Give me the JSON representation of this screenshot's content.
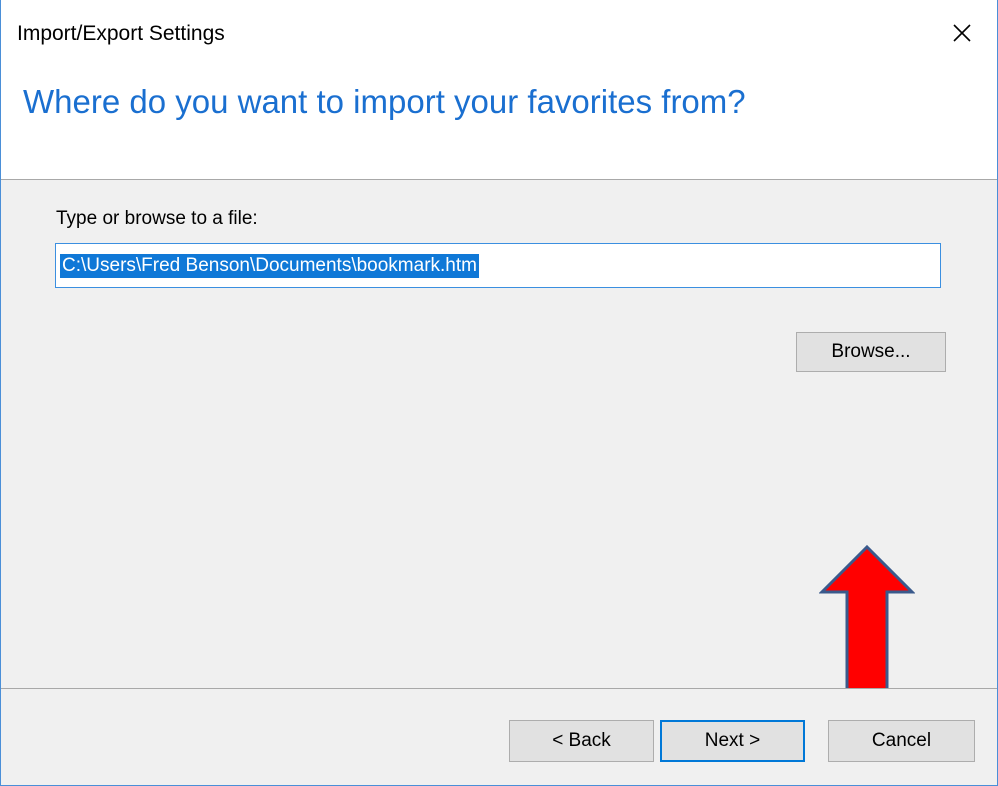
{
  "window": {
    "title": "Import/Export Settings",
    "close_icon": "close-icon"
  },
  "header": {
    "title": "Where do you want to import your favorites from?"
  },
  "main": {
    "field_label": "Type or browse to a file:",
    "file_path": "C:\\Users\\Fred Benson\\Documents\\bookmark.htm",
    "browse_label": "Browse..."
  },
  "footer": {
    "back_label": "< Back",
    "next_label": "Next >",
    "cancel_label": "Cancel"
  },
  "annotation": {
    "arrow_icon": "red-up-arrow-icon",
    "arrow_color": "#ff0000",
    "arrow_outline": "#3a5a8c"
  },
  "colors": {
    "accent": "#1a6fd0",
    "selection": "#0f78d7",
    "focus_border": "#0078d7"
  }
}
